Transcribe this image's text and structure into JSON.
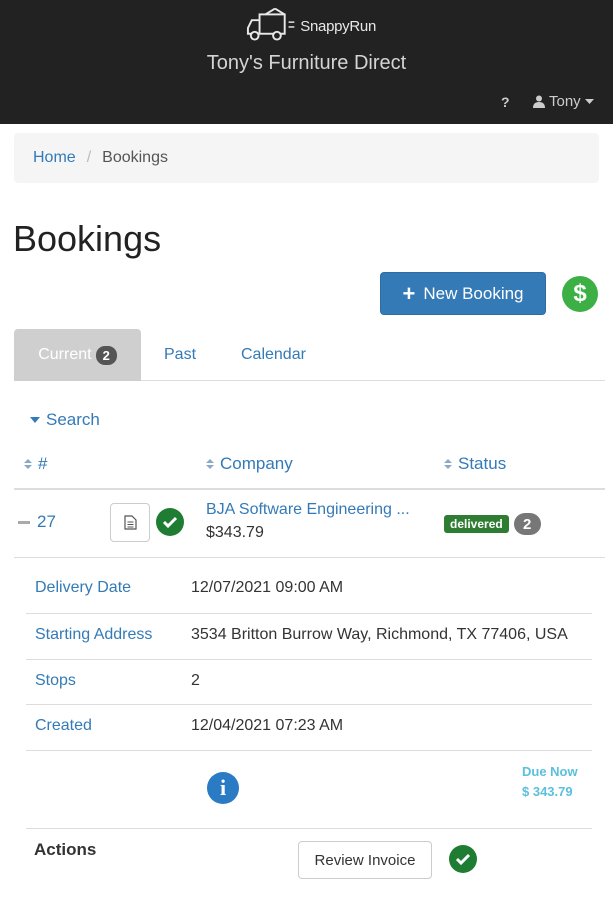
{
  "header": {
    "logo_text": "SnappyRun",
    "company_name": "Tony's Furniture Direct",
    "help_label": "?",
    "user_name": "Tony"
  },
  "breadcrumb": {
    "home": "Home",
    "separator": "/",
    "current": "Bookings"
  },
  "page": {
    "title": "Bookings",
    "new_booking_label": "New Booking",
    "dollar_symbol": "$"
  },
  "tabs": {
    "current_label": "Current",
    "current_count": "2",
    "past_label": "Past",
    "calendar_label": "Calendar"
  },
  "search": {
    "label": "Search"
  },
  "table": {
    "headers": {
      "number": "#",
      "company": "Company",
      "status": "Status"
    },
    "rows": [
      {
        "number": "27",
        "company": "BJA Software Engineering ...",
        "amount": "$343.79",
        "status": "delivered",
        "status_count": "2"
      }
    ]
  },
  "details": {
    "delivery_date_label": "Delivery Date",
    "delivery_date": "12/07/2021 09:00 AM",
    "starting_address_label": "Starting Address",
    "starting_address": "3534 Britton Burrow Way, Richmond, TX 77406, USA",
    "stops_label": "Stops",
    "stops": "2",
    "created_label": "Created",
    "created": "12/04/2021 07:23 AM",
    "info_glyph": "i",
    "due_label": "Due Now",
    "due_amount": "$ 343.79"
  },
  "actions": {
    "label": "Actions",
    "review_invoice_label": "Review Invoice"
  },
  "colors": {
    "header_bg": "#222222",
    "primary": "#337ab7",
    "success": "#2e7d32",
    "dollar_green": "#3cb044",
    "info_blue": "#2a7ac4",
    "due_cyan": "#5bc0de"
  },
  "icons": [
    "truck-logo-icon",
    "user-icon",
    "caret-down-icon",
    "plus-icon",
    "dollar-icon",
    "sort-icon",
    "minus-icon",
    "document-icon",
    "check-circle-icon",
    "info-icon"
  ]
}
